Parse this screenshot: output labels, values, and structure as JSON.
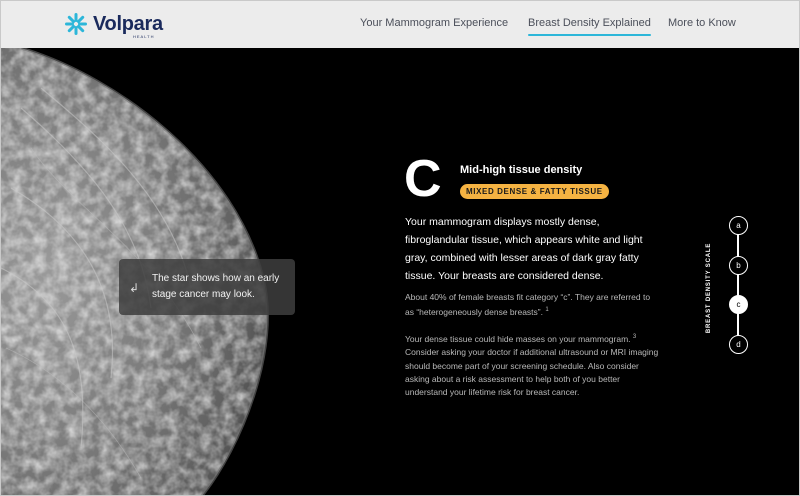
{
  "brand": {
    "name": "Volpara",
    "sub": "HEALTH",
    "accent": "#2cb6d9"
  },
  "nav": {
    "items": [
      {
        "label": "Your Mammogram Experience",
        "active": false
      },
      {
        "label": "Breast Density Explained",
        "active": true
      },
      {
        "label": "More to Know",
        "active": false
      }
    ]
  },
  "image": {
    "icon": "mammogram-image",
    "tooltip_icon": "hand-pointer-icon",
    "tooltip": "The star shows how an early stage cancer may look."
  },
  "category": {
    "letter": "C",
    "title": "Mid-high tissue density",
    "badge": "MIXED DENSE & FATTY TISSUE",
    "badge_color": "#f5b342",
    "lead": "Your mammogram displays mostly dense, fibroglandular tissue, which appears white and light gray, combined with lesser areas of dark gray fatty tissue. Your breasts are considered dense.",
    "para1": "About 40% of female breasts fit category “c”. They are referred to as “heterogeneously dense breasts”.",
    "para1_ref": "1",
    "para2_a": "Your dense tissue could hide masses on your mammogram.",
    "para2_ref": "3",
    "para2_b": " Consider asking your doctor if additional ultrasound or MRI imaging should become part of your screening schedule. Also consider asking about a risk assessment to help both of you better understand your lifetime risk for breast cancer."
  },
  "scale": {
    "label": "BREAST DENSITY SCALE",
    "levels": [
      "a",
      "b",
      "c",
      "d"
    ],
    "selected": "c"
  }
}
